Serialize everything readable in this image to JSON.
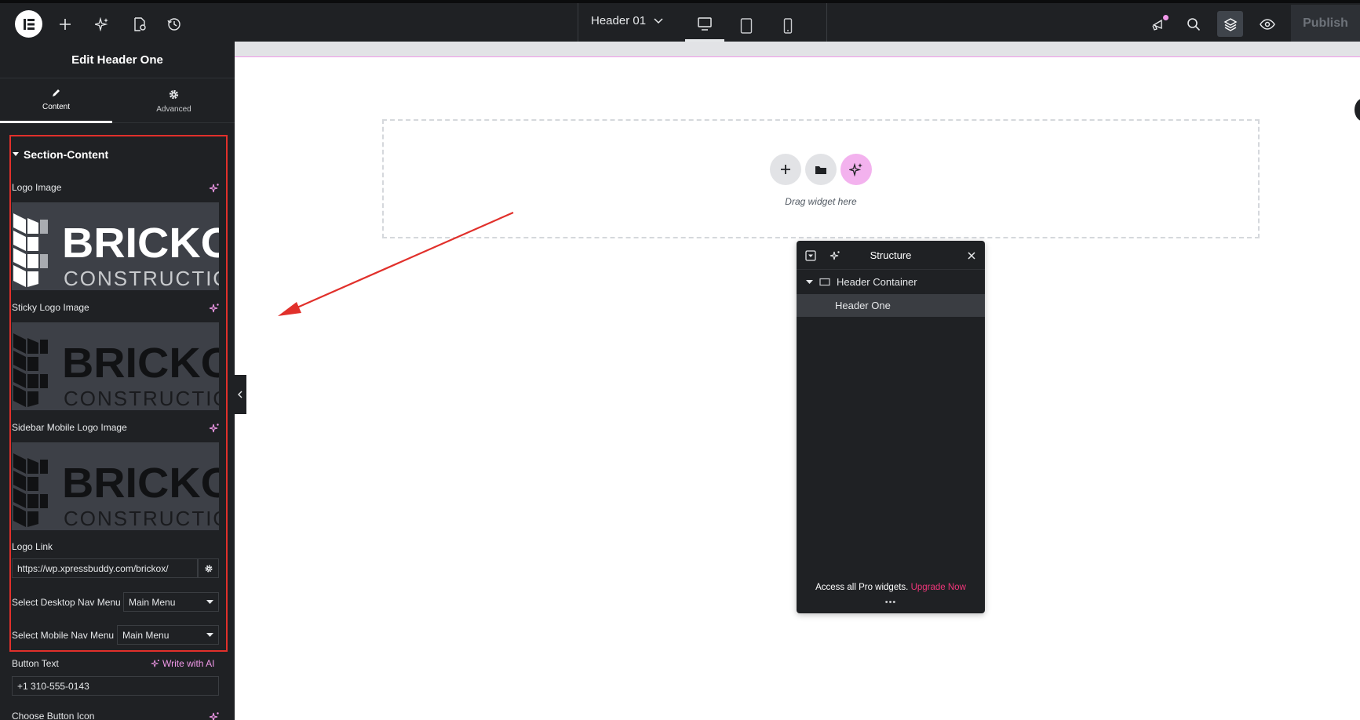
{
  "topbar": {
    "document_title": "Header 01",
    "publish_label": "Publish",
    "icons": [
      "elementor-logo-icon",
      "add-icon",
      "ai-sparkle-icon",
      "page-settings-icon",
      "history-icon",
      "chevron-down-icon",
      "desktop-icon",
      "tablet-icon",
      "mobile-icon",
      "whats-new-icon",
      "search-icon",
      "layers-icon",
      "preview-eye-icon"
    ]
  },
  "panel": {
    "title": "Edit Header One",
    "tabs": [
      {
        "label": "Content",
        "icon": "pencil-icon",
        "active": true
      },
      {
        "label": "Advanced",
        "icon": "gear-icon",
        "active": false
      }
    ],
    "section_title": "Section-Content",
    "logo_image_label": "Logo Image",
    "sticky_logo_label": "Sticky Logo Image",
    "sidebar_logo_label": "Sidebar Mobile Logo Image",
    "logo_word": "BRICKO",
    "logo_subword": "CONSTRUCTIO",
    "logo_link_label": "Logo Link",
    "logo_link_value": "https://wp.xpressbuddy.com/brickox/",
    "desktop_nav_label": "Select Desktop Nav Menu",
    "desktop_nav_value": "Main Menu",
    "mobile_nav_label": "Select Mobile Nav Menu",
    "mobile_nav_value": "Main Menu",
    "button_text_label": "Button Text",
    "write_ai_label": "Write with AI",
    "button_text_value": "+1 310-555-0143",
    "choose_icon_label": "Choose Button Icon"
  },
  "canvas": {
    "drag_text": "Drag widget here"
  },
  "structure": {
    "title": "Structure",
    "rows": [
      {
        "label": "Header Container",
        "level": 0
      },
      {
        "label": "Header One",
        "level": 1
      }
    ],
    "footer_text": "Access all Pro widgets.",
    "footer_link": "Upgrade Now",
    "footer_dots": "•••"
  },
  "colors": {
    "panel_bg": "#1f2124",
    "accent_pink": "#f199e9",
    "upgrade_link": "#f0367a",
    "highlight_box": "#e1302b",
    "annotation_arrow": "#e1302b"
  }
}
